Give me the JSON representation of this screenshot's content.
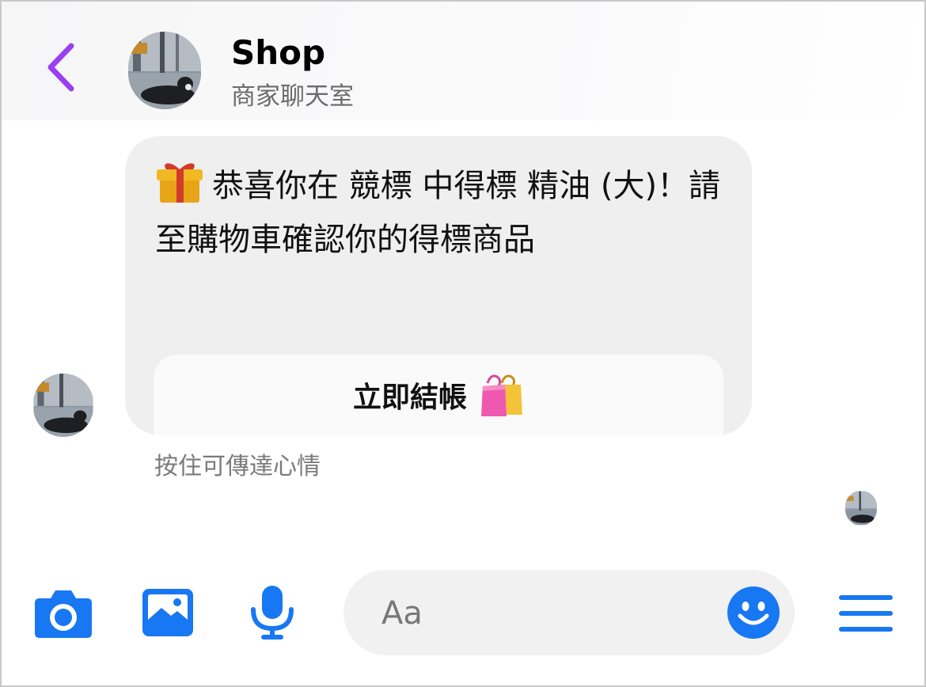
{
  "header": {
    "title": "Shop",
    "subtitle": "商家聊天室",
    "back_icon": "chevron-left-icon",
    "accent_color": "#9b3ff0"
  },
  "message": {
    "gift_icon": "gift-emoji",
    "text": "恭喜你在 競標 中得標 精油 (大)！請至購物車確認你的得標商品",
    "cta_label": "立即結帳",
    "cta_icon": "shopping-bags-emoji"
  },
  "hint": "按住可傳達心情",
  "composer": {
    "placeholder": "Aa",
    "icons": [
      "camera-icon",
      "gallery-icon",
      "microphone-icon",
      "smiley-icon",
      "menu-icon"
    ],
    "icon_color": "#1877f2"
  }
}
